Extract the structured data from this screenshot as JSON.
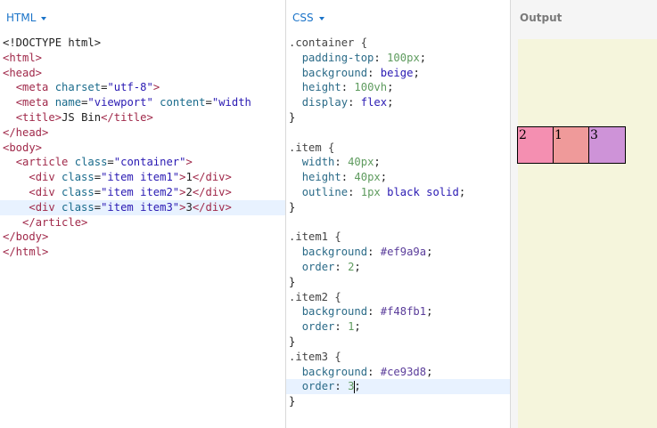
{
  "html_panel": {
    "title": "HTML",
    "lines": [
      {
        "id": "l1",
        "segments": [
          {
            "cls": "x",
            "text": "<!DOCTYPE html>"
          }
        ]
      },
      {
        "id": "l2",
        "segments": [
          {
            "cls": "t",
            "text": "<html>"
          }
        ]
      },
      {
        "id": "l3",
        "segments": [
          {
            "cls": "t",
            "text": "<head>"
          }
        ]
      },
      {
        "id": "l4",
        "segments": [
          {
            "cls": "x",
            "text": "  "
          },
          {
            "cls": "t",
            "text": "<meta "
          },
          {
            "cls": "a",
            "text": "charset"
          },
          {
            "cls": "x",
            "text": "="
          },
          {
            "cls": "s",
            "text": "\"utf-8\""
          },
          {
            "cls": "t",
            "text": ">"
          }
        ]
      },
      {
        "id": "l5",
        "segments": [
          {
            "cls": "x",
            "text": "  "
          },
          {
            "cls": "t",
            "text": "<meta "
          },
          {
            "cls": "a",
            "text": "name"
          },
          {
            "cls": "x",
            "text": "="
          },
          {
            "cls": "s",
            "text": "\"viewport\""
          },
          {
            "cls": "x",
            "text": " "
          },
          {
            "cls": "a",
            "text": "content"
          },
          {
            "cls": "x",
            "text": "="
          },
          {
            "cls": "s",
            "text": "\"width"
          }
        ]
      },
      {
        "id": "l6",
        "segments": [
          {
            "cls": "x",
            "text": "  "
          },
          {
            "cls": "t",
            "text": "<title>"
          },
          {
            "cls": "x",
            "text": "JS Bin"
          },
          {
            "cls": "t",
            "text": "</title>"
          }
        ]
      },
      {
        "id": "l7",
        "segments": [
          {
            "cls": "t",
            "text": "</head>"
          }
        ]
      },
      {
        "id": "l8",
        "segments": [
          {
            "cls": "t",
            "text": "<body>"
          }
        ]
      },
      {
        "id": "l9",
        "segments": [
          {
            "cls": "x",
            "text": "  "
          },
          {
            "cls": "t",
            "text": "<article "
          },
          {
            "cls": "a",
            "text": "class"
          },
          {
            "cls": "x",
            "text": "="
          },
          {
            "cls": "s",
            "text": "\"container\""
          },
          {
            "cls": "t",
            "text": ">"
          }
        ]
      },
      {
        "id": "l10",
        "segments": [
          {
            "cls": "x",
            "text": "    "
          },
          {
            "cls": "t",
            "text": "<div "
          },
          {
            "cls": "a",
            "text": "class"
          },
          {
            "cls": "x",
            "text": "="
          },
          {
            "cls": "s",
            "text": "\"item item1\""
          },
          {
            "cls": "t",
            "text": ">"
          },
          {
            "cls": "x",
            "text": "1"
          },
          {
            "cls": "t",
            "text": "</div>"
          }
        ]
      },
      {
        "id": "l11",
        "segments": [
          {
            "cls": "x",
            "text": "    "
          },
          {
            "cls": "t",
            "text": "<div "
          },
          {
            "cls": "a",
            "text": "class"
          },
          {
            "cls": "x",
            "text": "="
          },
          {
            "cls": "s",
            "text": "\"item item2\""
          },
          {
            "cls": "t",
            "text": ">"
          },
          {
            "cls": "x",
            "text": "2"
          },
          {
            "cls": "t",
            "text": "</div>"
          }
        ]
      },
      {
        "id": "l12",
        "highlight": true,
        "segments": [
          {
            "cls": "x",
            "text": "    "
          },
          {
            "cls": "t",
            "text": "<div "
          },
          {
            "cls": "a",
            "text": "class"
          },
          {
            "cls": "x",
            "text": "="
          },
          {
            "cls": "s",
            "text": "\"item item3\""
          },
          {
            "cls": "t",
            "text": ">"
          },
          {
            "cls": "x",
            "text": "3"
          },
          {
            "cls": "t",
            "text": "</div>"
          }
        ]
      },
      {
        "id": "l13",
        "segments": [
          {
            "cls": "x",
            "text": "   "
          },
          {
            "cls": "t",
            "text": "</article>"
          }
        ]
      },
      {
        "id": "l14",
        "segments": [
          {
            "cls": "t",
            "text": "</body>"
          }
        ]
      },
      {
        "id": "l15",
        "segments": [
          {
            "cls": "t",
            "text": "</html>"
          }
        ]
      }
    ]
  },
  "css_panel": {
    "title": "CSS",
    "lines": [
      {
        "id": "c1",
        "segments": [
          {
            "cls": "sel",
            "text": ".container {"
          }
        ]
      },
      {
        "id": "c2",
        "segments": [
          {
            "cls": "x",
            "text": "  "
          },
          {
            "cls": "p",
            "text": "padding-top"
          },
          {
            "cls": "x",
            "text": ": "
          },
          {
            "cls": "n",
            "text": "100px"
          },
          {
            "cls": "x",
            "text": ";"
          }
        ]
      },
      {
        "id": "c3",
        "segments": [
          {
            "cls": "x",
            "text": "  "
          },
          {
            "cls": "p",
            "text": "background"
          },
          {
            "cls": "x",
            "text": ": "
          },
          {
            "cls": "k",
            "text": "beige"
          },
          {
            "cls": "x",
            "text": ";"
          }
        ]
      },
      {
        "id": "c4",
        "segments": [
          {
            "cls": "x",
            "text": "  "
          },
          {
            "cls": "p",
            "text": "height"
          },
          {
            "cls": "x",
            "text": ": "
          },
          {
            "cls": "n",
            "text": "100vh"
          },
          {
            "cls": "x",
            "text": ";"
          }
        ]
      },
      {
        "id": "c5",
        "segments": [
          {
            "cls": "x",
            "text": "  "
          },
          {
            "cls": "p",
            "text": "display"
          },
          {
            "cls": "x",
            "text": ": "
          },
          {
            "cls": "k",
            "text": "flex"
          },
          {
            "cls": "x",
            "text": ";"
          }
        ]
      },
      {
        "id": "c6",
        "segments": [
          {
            "cls": "x",
            "text": "}"
          }
        ]
      },
      {
        "id": "c7",
        "segments": [
          {
            "cls": "x",
            "text": ""
          }
        ]
      },
      {
        "id": "c8",
        "segments": [
          {
            "cls": "sel",
            "text": ".item {"
          }
        ]
      },
      {
        "id": "c9",
        "segments": [
          {
            "cls": "x",
            "text": "  "
          },
          {
            "cls": "p",
            "text": "width"
          },
          {
            "cls": "x",
            "text": ": "
          },
          {
            "cls": "n",
            "text": "40px"
          },
          {
            "cls": "x",
            "text": ";"
          }
        ]
      },
      {
        "id": "c10",
        "segments": [
          {
            "cls": "x",
            "text": "  "
          },
          {
            "cls": "p",
            "text": "height"
          },
          {
            "cls": "x",
            "text": ": "
          },
          {
            "cls": "n",
            "text": "40px"
          },
          {
            "cls": "x",
            "text": ";"
          }
        ]
      },
      {
        "id": "c11",
        "segments": [
          {
            "cls": "x",
            "text": "  "
          },
          {
            "cls": "p",
            "text": "outline"
          },
          {
            "cls": "x",
            "text": ": "
          },
          {
            "cls": "n",
            "text": "1px"
          },
          {
            "cls": "x",
            "text": " "
          },
          {
            "cls": "k",
            "text": "black solid"
          },
          {
            "cls": "x",
            "text": ";"
          }
        ]
      },
      {
        "id": "c12",
        "segments": [
          {
            "cls": "x",
            "text": "}"
          }
        ]
      },
      {
        "id": "c13",
        "segments": [
          {
            "cls": "x",
            "text": ""
          }
        ]
      },
      {
        "id": "c14",
        "segments": [
          {
            "cls": "sel",
            "text": ".item1 {"
          }
        ]
      },
      {
        "id": "c15",
        "segments": [
          {
            "cls": "x",
            "text": "  "
          },
          {
            "cls": "p",
            "text": "background"
          },
          {
            "cls": "x",
            "text": ": "
          },
          {
            "cls": "c",
            "text": "#ef9a9a"
          },
          {
            "cls": "x",
            "text": ";"
          }
        ]
      },
      {
        "id": "c16",
        "segments": [
          {
            "cls": "x",
            "text": "  "
          },
          {
            "cls": "p",
            "text": "order"
          },
          {
            "cls": "x",
            "text": ": "
          },
          {
            "cls": "n",
            "text": "2"
          },
          {
            "cls": "x",
            "text": ";"
          }
        ]
      },
      {
        "id": "c17",
        "segments": [
          {
            "cls": "x",
            "text": "}"
          }
        ]
      },
      {
        "id": "c18",
        "segments": [
          {
            "cls": "sel",
            "text": ".item2 {"
          }
        ]
      },
      {
        "id": "c19",
        "segments": [
          {
            "cls": "x",
            "text": "  "
          },
          {
            "cls": "p",
            "text": "background"
          },
          {
            "cls": "x",
            "text": ": "
          },
          {
            "cls": "c",
            "text": "#f48fb1"
          },
          {
            "cls": "x",
            "text": ";"
          }
        ]
      },
      {
        "id": "c20",
        "segments": [
          {
            "cls": "x",
            "text": "  "
          },
          {
            "cls": "p",
            "text": "order"
          },
          {
            "cls": "x",
            "text": ": "
          },
          {
            "cls": "n",
            "text": "1"
          },
          {
            "cls": "x",
            "text": ";"
          }
        ]
      },
      {
        "id": "c21",
        "segments": [
          {
            "cls": "x",
            "text": "}"
          }
        ]
      },
      {
        "id": "c22",
        "segments": [
          {
            "cls": "sel",
            "text": ".item3 {"
          }
        ]
      },
      {
        "id": "c23",
        "segments": [
          {
            "cls": "x",
            "text": "  "
          },
          {
            "cls": "p",
            "text": "background"
          },
          {
            "cls": "x",
            "text": ": "
          },
          {
            "cls": "c",
            "text": "#ce93d8"
          },
          {
            "cls": "x",
            "text": ";"
          }
        ]
      },
      {
        "id": "c24",
        "highlight": true,
        "cursor_after_seg": 3,
        "segments": [
          {
            "cls": "x",
            "text": "  "
          },
          {
            "cls": "p",
            "text": "order"
          },
          {
            "cls": "x",
            "text": ": "
          },
          {
            "cls": "n",
            "text": "3"
          },
          {
            "cls": "x",
            "text": ";"
          }
        ]
      },
      {
        "id": "c25",
        "segments": [
          {
            "cls": "x",
            "text": "}"
          }
        ]
      }
    ]
  },
  "output_panel": {
    "title": "Output",
    "items": [
      {
        "label": "2",
        "color": "#f48fb1"
      },
      {
        "label": "1",
        "color": "#ef9a9a"
      },
      {
        "label": "3",
        "color": "#ce93d8"
      }
    ]
  },
  "colors": {
    "tab_accent": "#1a73c8",
    "container_bg": "#f5f5dc",
    "highlight_line": "#e8f2ff"
  },
  "icons": {
    "dropdown": "caret-down-icon"
  }
}
